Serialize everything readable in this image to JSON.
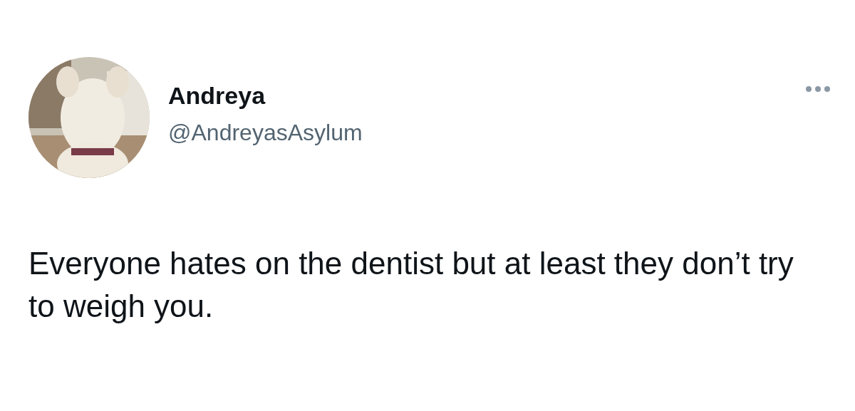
{
  "tweet": {
    "author": {
      "name": "Andreya",
      "handle": "@AndreyasAsylum"
    },
    "text": "Everyone hates on the dentist but at least they don’t try to weigh you."
  }
}
